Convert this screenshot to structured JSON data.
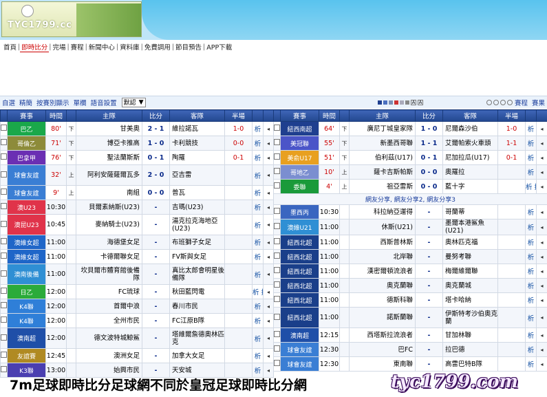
{
  "brand": {
    "logo_text": "TYC1799.cc"
  },
  "nav": {
    "items": [
      "首頁",
      "即時比分",
      "完場",
      "賽程",
      "新聞中心",
      "資料庫",
      "免費調用",
      "節目預告",
      "APP下載"
    ]
  },
  "toolbar": {
    "links": [
      "自選",
      "精簡",
      "按賽別顯示",
      "單欄",
      "語音設置"
    ],
    "select_value": "默認",
    "right_links": [
      "賽程",
      "賽果"
    ],
    "square_colors": [
      "#1f3f8f",
      "#4a6fbf",
      "#7a8fb5",
      "#c33",
      "#aab",
      "#888"
    ]
  },
  "headers": {
    "league": "賽事",
    "time": "時間",
    "home": "主隊",
    "score": "比分",
    "away": "客隊",
    "half": "半場",
    "analysis": "析"
  },
  "left_rows": [
    {
      "league": "巴乙",
      "color": "#1aa84a",
      "time": "80'",
      "time_red": true,
      "half": "下",
      "home": "甘美奧",
      "score": "2 - 1",
      "away": "維拉諾瓦",
      "ht": "1-0",
      "an": "析",
      "tall": false
    },
    {
      "league": "哥倫乙",
      "color": "#8d8b3a",
      "time": "71'",
      "time_red": true,
      "half": "下",
      "home": "博亞卡推高",
      "score": "1 - 0",
      "away": "卡利競技",
      "ht": "0-0",
      "an": "析",
      "tall": false
    },
    {
      "league": "巴拿甲",
      "color": "#6b2fb3",
      "time": "76'",
      "time_red": true,
      "half": "下",
      "home": "聖法蘭斯斯",
      "score": "0 - 1",
      "away": "陶羅",
      "ht": "0-1",
      "an": "析",
      "tall": false
    },
    {
      "league": "球會友誼",
      "color": "#3a7ed4",
      "time": "32'",
      "time_red": true,
      "half": "上",
      "home": "阿利安薩薩爾瓦多",
      "score": "2 - 0",
      "away": "亞吉雷",
      "ht": "",
      "an": "析",
      "tall": true
    },
    {
      "league": "球會友誼",
      "color": "#3a7ed4",
      "time": "9'",
      "time_red": true,
      "half": "上",
      "home": "南組",
      "score": "0 - 0",
      "away": "普瓦",
      "ht": "",
      "an": "析",
      "tall": false
    },
    {
      "league": "澳U23",
      "color": "#e0334a",
      "time": "10:30",
      "time_red": false,
      "half": "",
      "home": "貝爾素納斯(U23)",
      "score": "-",
      "away": "吉瑪(U23)",
      "ht": "",
      "an": "析",
      "tall": false
    },
    {
      "league": "澳昆U23",
      "color": "#e0334a",
      "time": "10:45",
      "time_red": false,
      "half": "",
      "home": "麥納騎士(U23)",
      "score": "-",
      "away": "湯克拉克海地亞(U23)",
      "ht": "",
      "an": "析",
      "tall": true
    },
    {
      "league": "澳維女超",
      "color": "#1f66c8",
      "time": "11:00",
      "time_red": false,
      "half": "",
      "home": "海德堡女足",
      "score": "-",
      "away": "布班獅子女足",
      "ht": "",
      "an": "析",
      "tall": false
    },
    {
      "league": "澳維女超",
      "color": "#1f66c8",
      "time": "11:00",
      "time_red": false,
      "half": "",
      "home": "卡德爾聯女足",
      "score": "-",
      "away": "FV斯與女足",
      "ht": "",
      "an": "析",
      "tall": false
    },
    {
      "league": "澳南後備",
      "color": "#2f8fd4",
      "time": "11:00",
      "time_red": false,
      "half": "",
      "home": "坎貝爾市體育館後備隊",
      "score": "-",
      "away": "真比太郎會明星後備隊",
      "ht": "",
      "an": "析",
      "tall": true
    },
    {
      "league": "日乙",
      "color": "#2bab3a",
      "time": "12:00",
      "time_red": false,
      "half": "",
      "home": "FC琉球",
      "score": "-",
      "away": "秋田藍閃電",
      "ht": "",
      "an": "析 指",
      "tall": false
    },
    {
      "league": "K4聯",
      "color": "#2f7fd8",
      "time": "12:00",
      "time_red": false,
      "half": "",
      "home": "首爾中浪",
      "score": "-",
      "away": "春川市民",
      "ht": "",
      "an": "析",
      "tall": false
    },
    {
      "league": "K4聯",
      "color": "#2f7fd8",
      "time": "12:00",
      "time_red": false,
      "half": "",
      "home": "全州市民",
      "score": "-",
      "away": "FC江原B隊",
      "ht": "",
      "an": "析",
      "tall": false
    },
    {
      "league": "澳南超",
      "color": "#1f4fa8",
      "time": "12:00",
      "time_red": false,
      "half": "",
      "home": "德文波特城鯨鯊",
      "score": "-",
      "away": "塔維爾詹德奧林匹克",
      "ht": "",
      "an": "析",
      "tall": true
    },
    {
      "league": "友誼賽",
      "color": "#b08a22",
      "time": "12:45",
      "time_red": false,
      "half": "",
      "home": "澳洲女足",
      "score": "-",
      "away": "加拿大女足",
      "ht": "",
      "an": "析",
      "tall": false
    },
    {
      "league": "K3聯",
      "color": "#4a3fb0",
      "time": "13:00",
      "time_red": false,
      "half": "",
      "home": "始興市民",
      "score": "-",
      "away": "天安城",
      "ht": "",
      "an": "析",
      "tall": false
    }
  ],
  "right_rows": [
    {
      "league": "紐西南超",
      "color": "#1f3f8f",
      "time": "64'",
      "time_red": true,
      "half": "下",
      "home": "廣尼丁城皇家隊",
      "score": "1 - 0",
      "away": "尼爾森沙伯",
      "ht": "1-0",
      "an": "析",
      "tall": false
    },
    {
      "league": "美冠聯",
      "color": "#4b55c8",
      "time": "55'",
      "time_red": true,
      "half": "下",
      "home": "新墨西哥聯",
      "score": "1 - 1",
      "away": "艾爾帕索火車頭",
      "ht": "1-1",
      "an": "析",
      "tall": false
    },
    {
      "league": "美俞U17",
      "color": "#e8a020",
      "time": "51'",
      "time_red": true,
      "half": "下",
      "home": "伯利茲(U17)",
      "score": "0 - 1",
      "away": "尼加拉瓜(U17)",
      "ht": "0-1",
      "an": "析",
      "tall": false
    },
    {
      "league": "哥地乙",
      "color": "#7b8ed0",
      "time": "10'",
      "time_red": true,
      "half": "上",
      "home": "薩卡吉斯帕斯",
      "score": "0 - 0",
      "away": "奧羅拉",
      "ht": "",
      "an": "析",
      "tall": false
    },
    {
      "league": "委聯",
      "color": "#1a9a3a",
      "time": "4'",
      "time_red": true,
      "half": "上",
      "home": "祖亞雷斯",
      "score": "0 - 0",
      "away": "藍十字",
      "ht": "",
      "an": "析 指",
      "tall": false
    }
  ],
  "right_info": "網友分享, 網友分享2, 網友分享3",
  "right_rows2": [
    {
      "league": "墨西丙",
      "color": "#3a66c0",
      "time": "10:30",
      "home": "科拉納亞運得",
      "score": "-",
      "away": "哥蘭蒂",
      "an": "析",
      "tall": false
    },
    {
      "league": "澳維U21",
      "color": "#2f8fd4",
      "time": "11:00",
      "home": "休斯(U21)",
      "score": "-",
      "away": "墨爾本港鯊魚(U21)",
      "an": "析",
      "tall": false
    },
    {
      "league": "紐西北超",
      "color": "#1a3f8a",
      "time": "11:00",
      "home": "西斯普林斯",
      "score": "-",
      "away": "奧林匹克福",
      "an": "析",
      "tall": false
    },
    {
      "league": "紐西北超",
      "color": "#1a3f8a",
      "time": "11:00",
      "home": "北岸聯",
      "score": "-",
      "away": "曼努考聯",
      "an": "析",
      "tall": false
    },
    {
      "league": "紐西北超",
      "color": "#1a3f8a",
      "time": "11:00",
      "home": "漢密爾頓流浪者",
      "score": "-",
      "away": "梅爾維爾聯",
      "an": "析",
      "tall": false
    },
    {
      "league": "紐西北超",
      "color": "#1a3f8a",
      "time": "11:00",
      "home": "奧克蘭聯",
      "score": "-",
      "away": "奧克蘭城",
      "an": "析",
      "tall": false
    },
    {
      "league": "紐西北超",
      "color": "#1a3f8a",
      "time": "11:00",
      "home": "德斯科聯",
      "score": "-",
      "away": "塔卡哈納",
      "an": "析",
      "tall": false
    },
    {
      "league": "紐西北超",
      "color": "#1a3f8a",
      "time": "11:00",
      "home": "諾斯蘭聯",
      "score": "-",
      "away": "伊斯特考沙伯奧克蘭",
      "an": "析",
      "tall": true
    },
    {
      "league": "澳南超",
      "color": "#1f4fa8",
      "time": "12:15",
      "home": "西塔斯拉流浪者",
      "score": "-",
      "away": "甘加林聯",
      "an": "析",
      "tall": false
    },
    {
      "league": "球會友誼",
      "color": "#3a7ed4",
      "time": "12:30",
      "home": "巴FC",
      "score": "-",
      "away": "拉巴德",
      "an": "析",
      "tall": false
    },
    {
      "league": "球會友誼",
      "color": "#3a7ed4",
      "time": "12:30",
      "home": "東南聯",
      "score": "-",
      "away": "高雷巴特B隊",
      "an": "析",
      "tall": false
    }
  ],
  "watermark": {
    "caption": "7m足球即時比分足球網不同於皇冠足球即時比分網",
    "url": "tyc1799.com"
  }
}
